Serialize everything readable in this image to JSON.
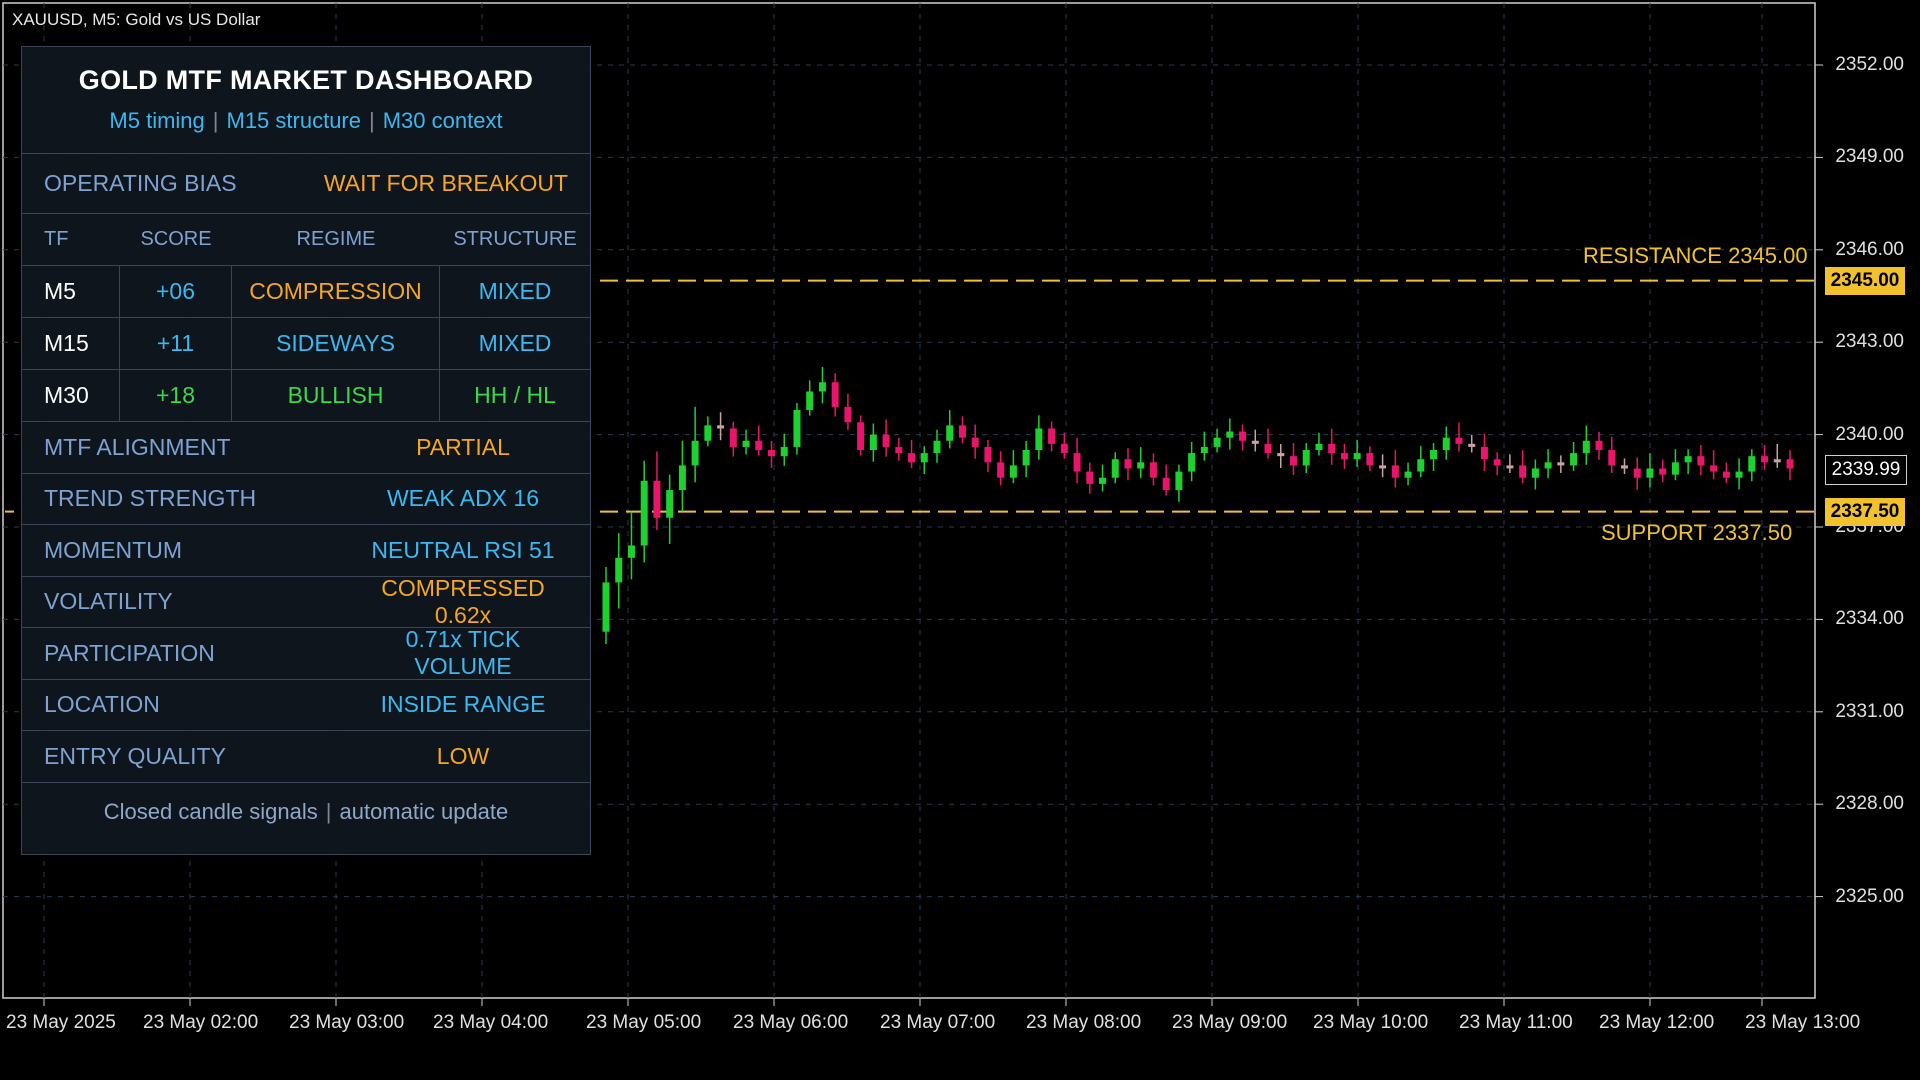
{
  "header": {
    "symbol_title": "XAUUSD, M5:  Gold vs US Dollar"
  },
  "colors": {
    "background": "#000000",
    "grid": "#2a3b4f",
    "bull_candle": "#1fd12e",
    "bear_candle": "#e8156a",
    "doji_candle": "#c9a3a3",
    "level_line": "#f2c12e",
    "accent_cyan": "#3cb8f0",
    "accent_orange": "#f5a623",
    "accent_green": "#3bd94a",
    "label_blue": "#7ea2d2"
  },
  "dashboard": {
    "title": "GOLD MTF MARKET DASHBOARD",
    "subtitle_parts": [
      "M5 timing",
      "M15 structure",
      "M30 context"
    ],
    "subtitle_separator": "|",
    "bias": {
      "label": "OPERATING BIAS",
      "value": "WAIT FOR BREAKOUT",
      "color": "#f5a623"
    },
    "table_headers": [
      "TF",
      "SCORE",
      "REGIME",
      "STRUCTURE"
    ],
    "table_rows": [
      {
        "tf": "M5",
        "score": "+06",
        "regime": "COMPRESSION",
        "structure": "MIXED",
        "score_color": "#3cb8f0",
        "regime_color": "#f5a623",
        "structure_color": "#3cb8f0"
      },
      {
        "tf": "M15",
        "score": "+11",
        "regime": "SIDEWAYS",
        "structure": "MIXED",
        "score_color": "#3cb8f0",
        "regime_color": "#3cb8f0",
        "structure_color": "#3cb8f0"
      },
      {
        "tf": "M30",
        "score": "+18",
        "regime": "BULLISH",
        "structure": "HH / HL",
        "score_color": "#3bd94a",
        "regime_color": "#3bd94a",
        "structure_color": "#3bd94a"
      }
    ],
    "metrics": [
      {
        "label": "MTF ALIGNMENT",
        "value": "PARTIAL",
        "color": "#f5a623"
      },
      {
        "label": "TREND STRENGTH",
        "value": "WEAK ADX 16",
        "color": "#3cb8f0"
      },
      {
        "label": "MOMENTUM",
        "value": "NEUTRAL RSI 51",
        "color": "#3cb8f0"
      },
      {
        "label": "VOLATILITY",
        "value": "COMPRESSED 0.62x",
        "color": "#f5a623"
      },
      {
        "label": "PARTICIPATION",
        "value": "0.71x TICK VOLUME",
        "color": "#3cb8f0"
      },
      {
        "label": "LOCATION",
        "value": "INSIDE RANGE",
        "color": "#3cb8f0"
      },
      {
        "label": "ENTRY QUALITY",
        "value": "LOW",
        "color": "#f5a623"
      }
    ],
    "footer_parts": [
      "Closed candle signals",
      "automatic update"
    ],
    "footer_separator": "|"
  },
  "levels": {
    "resistance": {
      "label": "RESISTANCE 2345.00",
      "price": 2345.0,
      "tag": "2345.00"
    },
    "support": {
      "label": "SUPPORT  2337.50",
      "price": 2337.5,
      "tag": "2337.50"
    },
    "current_price": {
      "price": 2338.85,
      "tag": "2339.99"
    }
  },
  "chart_data": {
    "type": "candlestick",
    "title": "XAUUSD, M5:  Gold vs US Dollar",
    "ylim": [
      2322.5,
      2353.5
    ],
    "y_ticks": [
      "2352.00",
      "2349.00",
      "2346.00",
      "2343.00",
      "2340.00",
      "2337.00",
      "2334.00",
      "2331.00",
      "2328.00",
      "2325.00"
    ],
    "y_tick_values": [
      2352,
      2349,
      2346,
      2343,
      2340,
      2337,
      2334,
      2331,
      2328,
      2325
    ],
    "x_ticks": [
      "23 May 2025",
      "23 May 02:00",
      "23 May 03:00",
      "23 May 04:00",
      "23 May 05:00",
      "23 May 06:00",
      "23 May 07:00",
      "23 May 08:00",
      "23 May 09:00",
      "23 May 10:00",
      "23 May 11:00",
      "23 May 12:00",
      "23 May 13:00"
    ],
    "grid": true,
    "candles_start": "23 May 04:50",
    "candle_interval": "5 min",
    "closes": [
      2335.2,
      2336.0,
      2336.4,
      2338.5,
      2337.3,
      2338.2,
      2339.0,
      2339.8,
      2340.3,
      2340.2,
      2339.6,
      2339.8,
      2339.5,
      2339.3,
      2339.6,
      2340.8,
      2341.4,
      2341.7,
      2340.9,
      2340.4,
      2339.5,
      2340.0,
      2339.6,
      2339.4,
      2339.1,
      2339.4,
      2339.8,
      2340.3,
      2339.9,
      2339.6,
      2339.1,
      2338.6,
      2339.0,
      2339.5,
      2340.2,
      2339.7,
      2339.4,
      2338.8,
      2338.4,
      2338.6,
      2339.2,
      2338.9,
      2339.1,
      2338.6,
      2338.2,
      2338.8,
      2339.4,
      2339.6,
      2339.9,
      2340.1,
      2339.8,
      2339.7,
      2339.4,
      2339.3,
      2339.0,
      2339.5,
      2339.7,
      2339.4,
      2339.2,
      2339.4,
      2339.0,
      2339.0,
      2338.6,
      2338.8,
      2339.2,
      2339.5,
      2339.9,
      2339.7,
      2339.6,
      2339.2,
      2339.0,
      2339.0,
      2338.6,
      2338.9,
      2339.1,
      2339.0,
      2339.4,
      2339.8,
      2339.5,
      2339.0,
      2338.9,
      2338.6,
      2338.9,
      2338.7,
      2339.1,
      2339.3,
      2339.0,
      2338.8,
      2338.6,
      2338.8,
      2339.3,
      2339.1,
      2339.2,
      2338.9
    ]
  }
}
